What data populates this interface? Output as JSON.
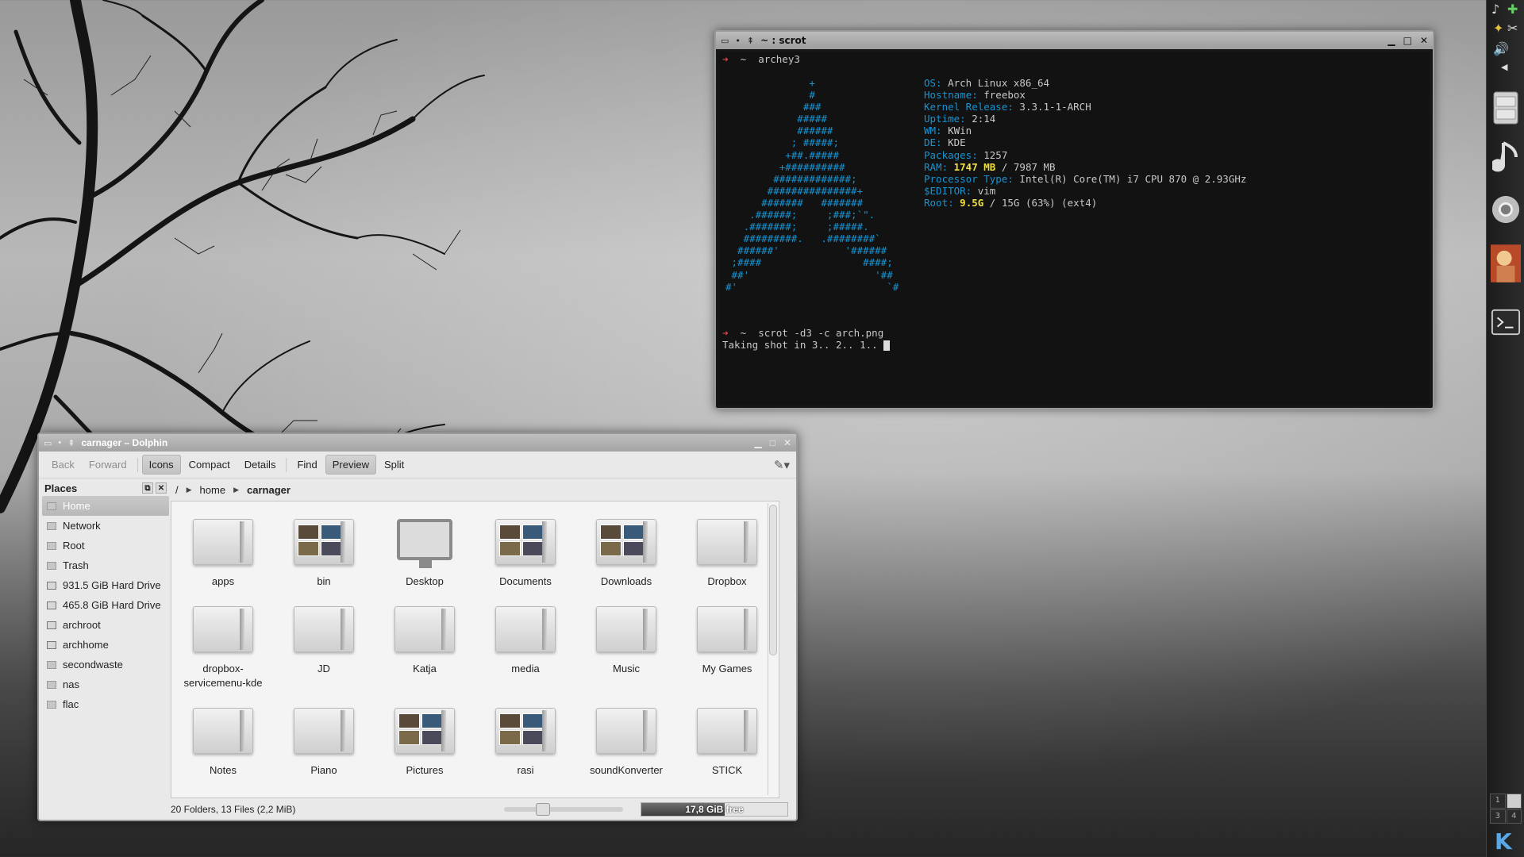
{
  "terminal": {
    "title": "~ : scrot",
    "command1": "archey3",
    "ascii_art": [
      "              +",
      "              #",
      "             ###",
      "            #####",
      "            ######",
      "           ; #####;",
      "          +##.#####",
      "         +##########",
      "        #############;",
      "       ###############+",
      "      #######   #######",
      "    .######;     ;###;`\".",
      "   .#######;     ;#####.",
      "   #########.   .########`",
      "  ######'           '######",
      " ;####                 ####;",
      " ##'                     '##",
      "#'                         `#"
    ],
    "info": [
      {
        "key": "OS:",
        "value": " Arch Linux x86_64"
      },
      {
        "key": "Hostname:",
        "value": " freebox"
      },
      {
        "key": "Kernel Release:",
        "value": " 3.3.1-1-ARCH"
      },
      {
        "key": "Uptime:",
        "value": " 2:14"
      },
      {
        "key": "WM:",
        "value": " KWin"
      },
      {
        "key": "DE:",
        "value": " KDE"
      },
      {
        "key": "Packages:",
        "value": " 1257"
      },
      {
        "key": "RAM:",
        "highlight": " 1747 MB",
        "value": " / 7987 MB"
      },
      {
        "key": "Processor Type:",
        "value": " Intel(R) Core(TM) i7 CPU 870 @ 2.93GHz"
      },
      {
        "key": "$EDITOR:",
        "value": " vim"
      },
      {
        "key": "Root:",
        "highlight": " 9.5G",
        "value": " / 15G (63%) (ext4)"
      }
    ],
    "prompt_symbol": "➜",
    "home_symbol": "~",
    "command2": "scrot -d3 -c arch.png",
    "output": "Taking shot in 3.. 2.. 1.. "
  },
  "dolphin": {
    "title": "carnager – Dolphin",
    "toolbar": {
      "back": "Back",
      "forward": "Forward",
      "icons": "Icons",
      "compact": "Compact",
      "details": "Details",
      "find": "Find",
      "preview": "Preview",
      "split": "Split"
    },
    "places_title": "Places",
    "places": [
      {
        "label": "Home",
        "selected": true,
        "type": "home"
      },
      {
        "label": "Network",
        "type": "network"
      },
      {
        "label": "Root",
        "type": "folder"
      },
      {
        "label": "Trash",
        "type": "trash"
      },
      {
        "label": "931.5 GiB Hard Drive",
        "type": "drive"
      },
      {
        "label": "465.8 GiB Hard Drive",
        "type": "drive"
      },
      {
        "label": "archroot",
        "type": "drive"
      },
      {
        "label": "archhome",
        "type": "drive"
      },
      {
        "label": "secondwaste",
        "type": "folder"
      },
      {
        "label": "nas",
        "type": "folder"
      },
      {
        "label": "flac",
        "type": "folder"
      }
    ],
    "breadcrumb": {
      "root": "/",
      "home": "home",
      "current": "carnager"
    },
    "items": [
      {
        "label": "apps",
        "kind": "folder"
      },
      {
        "label": "bin",
        "kind": "preview"
      },
      {
        "label": "Desktop",
        "kind": "desktop"
      },
      {
        "label": "Documents",
        "kind": "preview"
      },
      {
        "label": "Downloads",
        "kind": "preview"
      },
      {
        "label": "Dropbox",
        "kind": "folder"
      },
      {
        "label": "dropbox-\nservicemenu-kde",
        "kind": "folder"
      },
      {
        "label": "JD",
        "kind": "folder"
      },
      {
        "label": "Katja",
        "kind": "folder"
      },
      {
        "label": "media",
        "kind": "folder"
      },
      {
        "label": "Music",
        "kind": "folder"
      },
      {
        "label": "My Games",
        "kind": "folder"
      },
      {
        "label": "Notes",
        "kind": "folder"
      },
      {
        "label": "Piano",
        "kind": "folder"
      },
      {
        "label": "Pictures",
        "kind": "preview"
      },
      {
        "label": "rasi",
        "kind": "preview"
      },
      {
        "label": "soundKonverter",
        "kind": "folder"
      },
      {
        "label": "STICK",
        "kind": "folder"
      }
    ],
    "status": "20 Folders, 13 Files (2,2 MiB)",
    "free_space": "17,8 GiB free",
    "free_fraction": 0.57
  },
  "panel": {
    "pager": [
      "1",
      "",
      "3",
      "4"
    ]
  },
  "colors": {
    "arch_blue": "#1793d1",
    "prompt_red": "#e04848",
    "highlight_yellow": "#f0e040"
  }
}
